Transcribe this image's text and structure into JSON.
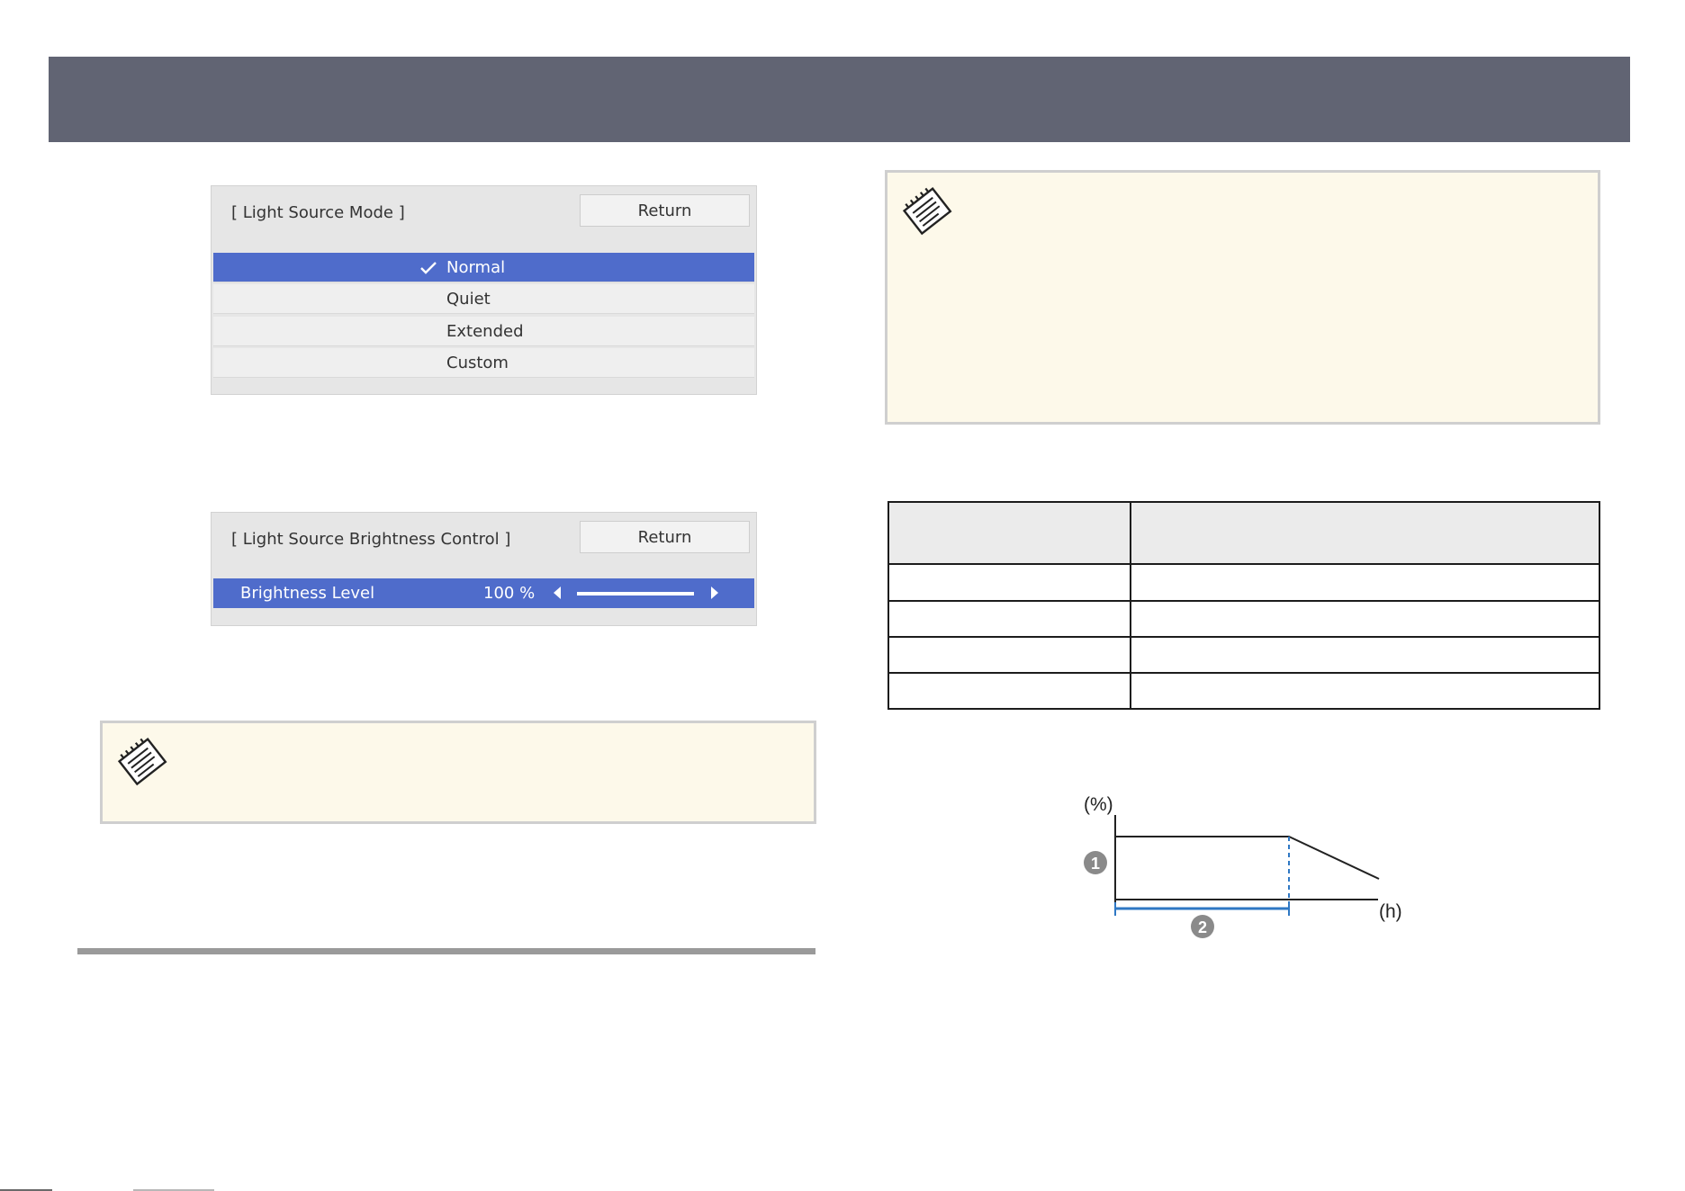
{
  "light_source_mode_menu": {
    "title": "[ Light Source Mode ]",
    "return_label": "Return",
    "options": [
      {
        "label": "Normal",
        "selected": true
      },
      {
        "label": "Quiet",
        "selected": false
      },
      {
        "label": "Extended",
        "selected": false
      },
      {
        "label": "Custom",
        "selected": false
      }
    ]
  },
  "brightness_menu": {
    "title": "[ Light Source Brightness Control ]",
    "return_label": "Return",
    "item_label": "Brightness Level",
    "item_value": "100 %",
    "slider_level": 1.0
  },
  "graph": {
    "y_unit": "(%)",
    "x_unit": "(h)",
    "callout_1": "1",
    "callout_2": "2"
  },
  "colors": {
    "banner": "#616473",
    "selected_row": "#4f6ccb",
    "note_background": "#fdf9ea",
    "graph_accent": "#2f78c4"
  },
  "icons": [
    "check-icon",
    "note-icon",
    "left-arrow-icon",
    "right-arrow-icon"
  ]
}
